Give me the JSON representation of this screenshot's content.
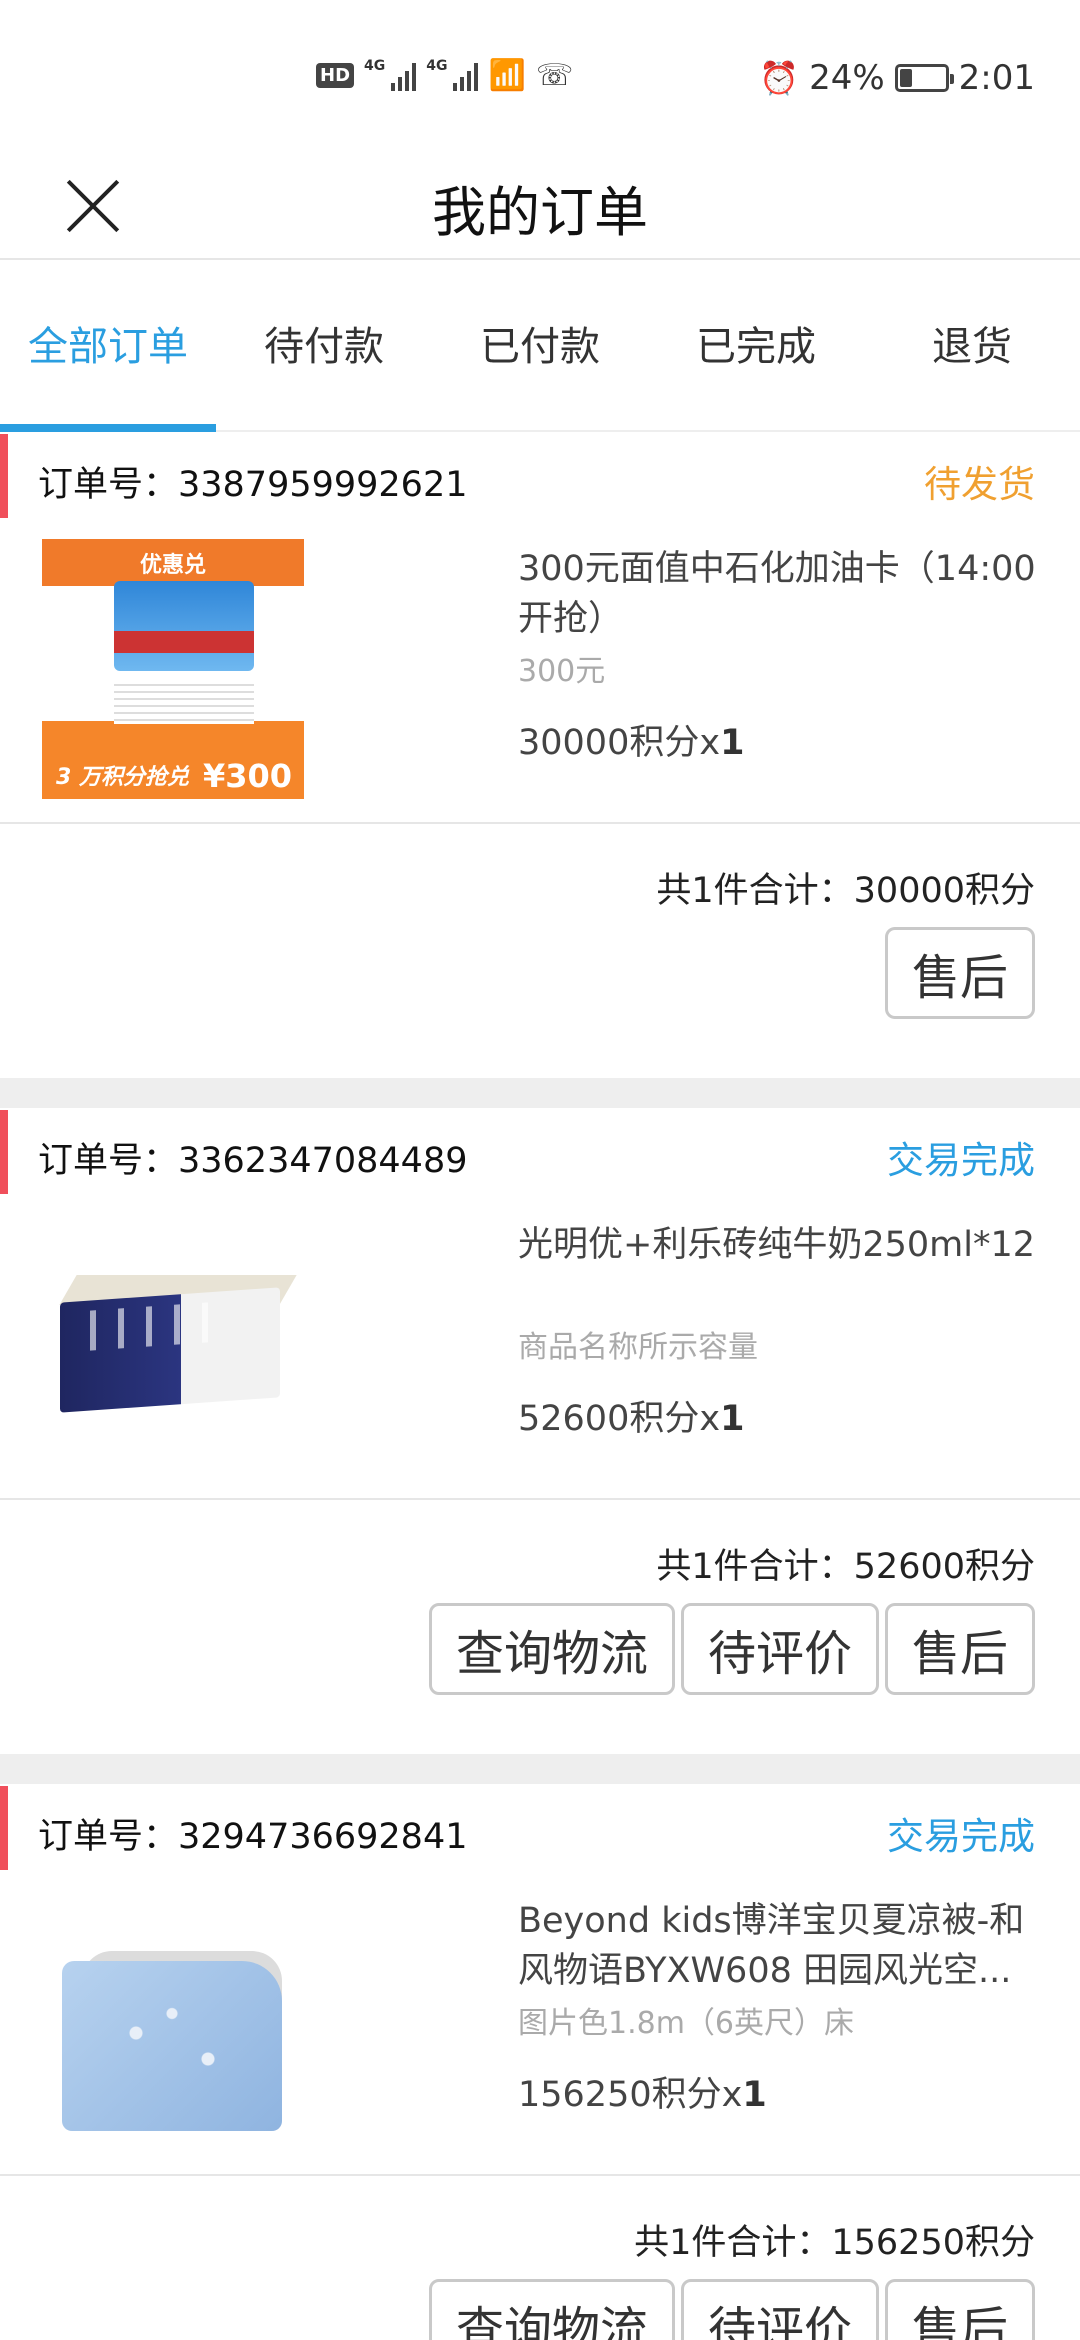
{
  "status_bar": {
    "battery_percent": "24%",
    "time": "2:01",
    "network": "4G",
    "hd": "HD",
    "battery_level": 0.24
  },
  "header": {
    "title": "我的订单"
  },
  "tabs": [
    {
      "label": "全部订单",
      "active": true
    },
    {
      "label": "待付款",
      "active": false
    },
    {
      "label": "已付款",
      "active": false
    },
    {
      "label": "已完成",
      "active": false
    },
    {
      "label": "退货",
      "active": false
    }
  ],
  "colors": {
    "accent": "#2a9ee0",
    "pending": "#f0a030",
    "done": "#2a9ee0",
    "left_bar": "#f04f5b"
  },
  "orders": [
    {
      "order_no": "订单号：3387959992621",
      "status": "待发货",
      "status_type": "pending",
      "product_name": "300元面值中石化加油卡（14:00开抢）",
      "spec": "300元",
      "price": "30000积分x",
      "qty": "1",
      "image_texts": {
        "badge": "优惠兑",
        "points": "3 万积分抢兑",
        "amount": "¥300"
      },
      "total": "共1件合计：30000积分",
      "buttons": [
        "售后"
      ]
    },
    {
      "order_no": "订单号：3362347084489",
      "status": "交易完成",
      "status_type": "done",
      "product_name": "光明优+利乐砖纯牛奶250ml*12",
      "spec": "商品名称所示容量",
      "price": "52600积分x",
      "qty": "1",
      "total": "共1件合计：52600积分",
      "buttons": [
        "查询物流",
        "待评价",
        "售后"
      ]
    },
    {
      "order_no": "订单号：3294736692841",
      "status": "交易完成",
      "status_type": "done",
      "product_name": "Beyond kids博洋宝贝夏凉被-和风物语BYXW608 田园风光空...",
      "spec": "图片色1.8m（6英尺）床",
      "price": "156250积分x",
      "qty": "1",
      "total": "共1件合计：156250积分",
      "buttons": [
        "查询物流",
        "待评价",
        "售后"
      ]
    }
  ]
}
